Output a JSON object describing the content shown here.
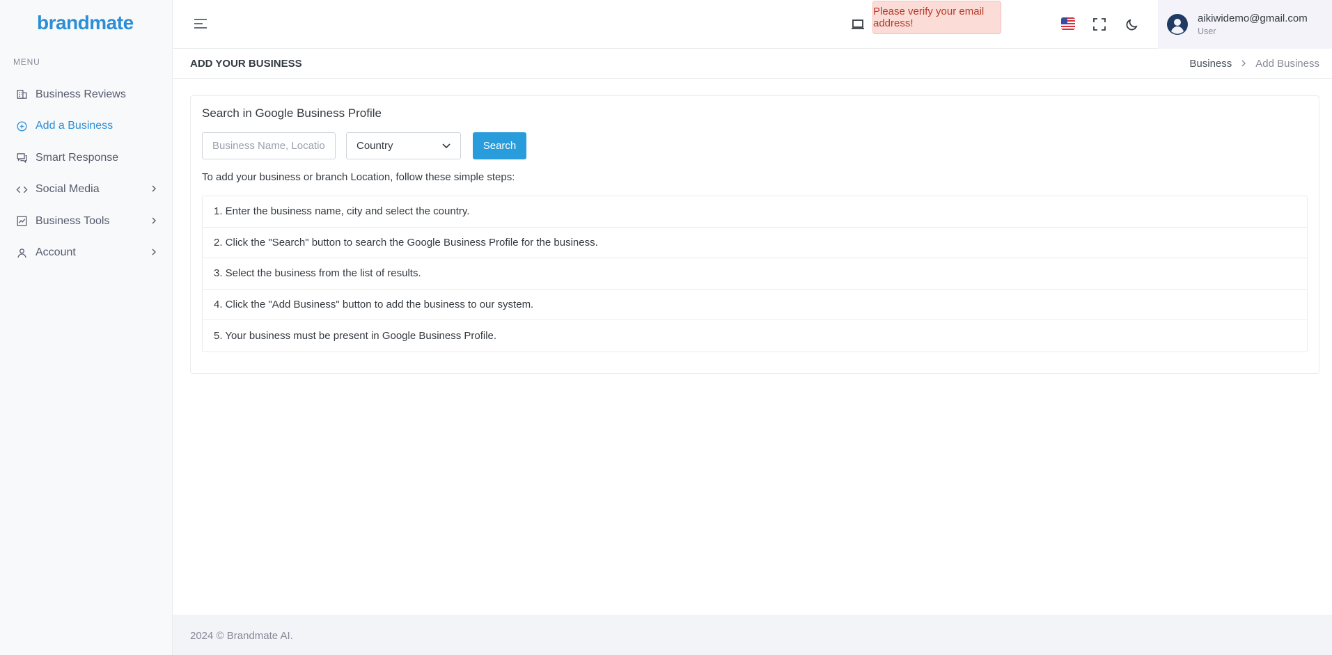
{
  "app": {
    "logo": "brandmate",
    "brand_color": "#2b8ed6"
  },
  "sidebar": {
    "menu_title": "MENU",
    "items": [
      {
        "label": "Business Reviews",
        "icon": "building-icon",
        "active": false,
        "has_submenu": false
      },
      {
        "label": "Add a Business",
        "icon": "plus-circle-icon",
        "active": true,
        "has_submenu": false
      },
      {
        "label": "Smart Response",
        "icon": "chat-icon",
        "active": false,
        "has_submenu": false
      },
      {
        "label": "Social Media",
        "icon": "code-icon",
        "active": false,
        "has_submenu": true
      },
      {
        "label": "Business Tools",
        "icon": "chart-icon",
        "active": false,
        "has_submenu": true
      },
      {
        "label": "Account",
        "icon": "user-icon",
        "active": false,
        "has_submenu": true
      }
    ]
  },
  "topbar": {
    "verify_message": "Please verify your email address!",
    "language_flag": "us-flag-icon",
    "user": {
      "email": "aikiwidemo@gmail.com",
      "role": "User"
    }
  },
  "page": {
    "title": "ADD YOUR BUSINESS",
    "breadcrumb": {
      "parent": "Business",
      "current": "Add Business"
    }
  },
  "search_card": {
    "title": "Search in Google Business Profile",
    "input_placeholder": "Business Name, Location",
    "country_select": "Country",
    "search_button": "Search",
    "intro": "To add your business or branch Location, follow these simple steps:",
    "steps": [
      "1. Enter the business name, city and select the country.",
      "2. Click the \"Search\" button to search the Google Business Profile for the business.",
      "3. Select the business from the list of results.",
      "4. Click the \"Add Business\" button to add the business to our system.",
      "5. Your business must be present in Google Business Profile."
    ]
  },
  "footer": {
    "text": "2024 © Brandmate AI."
  },
  "colors": {
    "primary_button": "#299cdb",
    "alert_bg": "#fbdcd7",
    "alert_text": "#b63b2b"
  }
}
